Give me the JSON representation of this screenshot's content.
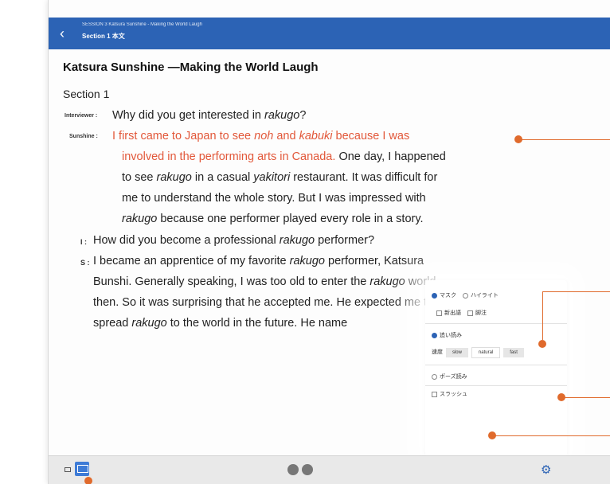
{
  "topbar": {
    "subtitle": "SESSION 3 Katsura Sunshine - Making the World Laugh",
    "title": "Section 1 本文"
  },
  "content": {
    "title": "Katsura Sunshine —Making the World Laugh",
    "section": "Section 1",
    "lines": {
      "l1_speaker": "Interviewer :",
      "l1_a": "Why did you get interested in ",
      "l1_b": "rakugo",
      "l1_c": "?",
      "l2_speaker": "Sunshine :",
      "l2_a": "I first came to Japan to see ",
      "l2_b": "noh",
      "l2_c": " and ",
      "l2_d": "kabuki",
      "l2_e": " because I was",
      "l3_a": "involved in the performing arts in Canada.",
      "l3_b": "One day, I happened",
      "l4_a": "to see ",
      "l4_b": "rakugo",
      "l4_c": " in a casual ",
      "l4_d": "yakitori",
      "l4_e": " restaurant.  It was difficult for",
      "l5": "me to understand the whole story.  But I was impressed with",
      "l6_a": "rakugo",
      "l6_b": " because one performer played every role in a story.",
      "l7_speaker": "I :",
      "l7_a": "How did you become a professional ",
      "l7_b": "rakugo",
      "l7_c": " performer?",
      "l8_speaker": "S :",
      "l8_a": "I became an apprentice of my favorite ",
      "l8_b": "rakugo",
      "l8_c": " performer, Katsura",
      "l9_a": "Bunshi.  Generally speaking, I was too old to enter the ",
      "l9_b": "rakugo",
      "l9_c": " world",
      "l10": "then.  So it was surprising that he accepted me.  He expected me to",
      "l11_a": "spread ",
      "l11_b": "rakugo",
      "l11_c": " to the world in the future.  He name"
    }
  },
  "popup": {
    "mask": "マスク",
    "highlight": "ハイライト",
    "new_words": "新出語",
    "notes": "脚注",
    "read_along": "追い読み",
    "speed_label": "速度",
    "speed_slow": "slow",
    "speed_natural": "natural",
    "speed_fast": "fast",
    "pause_read": "ポーズ読み",
    "slash": "スラッシュ"
  },
  "colors": {
    "topbar": "#2c63b5",
    "highlight_text": "#e2583a",
    "callout": "#e06a2c"
  }
}
